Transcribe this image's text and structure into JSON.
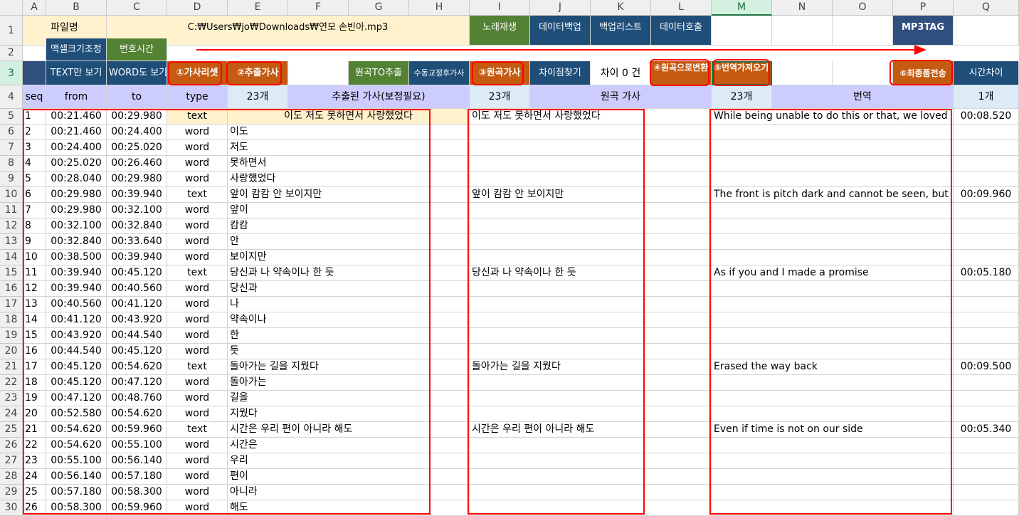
{
  "columns": [
    "A",
    "B",
    "C",
    "D",
    "E",
    "F",
    "G",
    "H",
    "I",
    "J",
    "K",
    "L",
    "M",
    "N",
    "O",
    "P",
    "Q"
  ],
  "row_numbers": [
    "1",
    "2",
    "3",
    "4",
    "5",
    "6",
    "7",
    "8",
    "9",
    "10",
    "11",
    "12",
    "13",
    "14",
    "15",
    "16",
    "17",
    "18",
    "19",
    "20",
    "21",
    "22",
    "23",
    "24",
    "25",
    "26",
    "27",
    "28",
    "29",
    "30"
  ],
  "row1": {
    "file_label": "파일명",
    "file_path": "C:₩Users₩jo₩Downloads₩연모 손빈아.mp3",
    "btn_play": "노래재생",
    "btn_backup": "데이터백업",
    "btn_backup_list": "백업리스트",
    "btn_data_load": "데이터호출",
    "btn_mp3tag": "MP3TAG"
  },
  "row2": {
    "btn_cell_size": "액셀크기조정",
    "btn_number_time": "번호시간"
  },
  "row3": {
    "btn_text_only": "TEXT만 보기",
    "btn_word_view": "WORD도 보기",
    "btn_lyrics_set": "①가사리셋",
    "btn_extract": "②추출가사",
    "btn_original_extract": "원곡TO추출",
    "btn_manual_fix": "수동교정후가사",
    "btn_original_lyrics": "③원곡가사",
    "btn_find_diff": "차이점찾기",
    "diff_count": "차이 0 건",
    "btn_convert_original": "④원곡으로변환",
    "btn_translate": "⑤번역가져오기",
    "btn_final_send": "⑥최종품전송",
    "time_diff_label": "시간차이"
  },
  "row4": {
    "seq": "seq",
    "from": "from",
    "to": "to",
    "type": "type",
    "extract_count": "23개",
    "extract_title": "추출된 가사(보정필요)",
    "original_count": "23개",
    "original_title": "원곡 가사",
    "translation_count": "23개",
    "translation_title": "번역",
    "time_diff_count": "1개"
  },
  "rows": [
    {
      "seq": "1",
      "from": "00:21.460",
      "to": "00:29.980",
      "type": "text",
      "lyric": "이도 저도 못하면서 사랑했었다",
      "original": "이도 저도 못하면서 사랑했었다",
      "translation": "While being unable to do this or that, we loved",
      "diff": "00:08.520"
    },
    {
      "seq": "2",
      "from": "00:21.460",
      "to": "00:24.400",
      "type": "word",
      "lyric": "이도",
      "original": "",
      "translation": "",
      "diff": ""
    },
    {
      "seq": "3",
      "from": "00:24.400",
      "to": "00:25.020",
      "type": "word",
      "lyric": "저도",
      "original": "",
      "translation": "",
      "diff": ""
    },
    {
      "seq": "4",
      "from": "00:25.020",
      "to": "00:26.460",
      "type": "word",
      "lyric": "못하면서",
      "original": "",
      "translation": "",
      "diff": ""
    },
    {
      "seq": "5",
      "from": "00:28.040",
      "to": "00:29.980",
      "type": "word",
      "lyric": "사랑했었다",
      "original": "",
      "translation": "",
      "diff": ""
    },
    {
      "seq": "6",
      "from": "00:29.980",
      "to": "00:39.940",
      "type": "text",
      "lyric": "앞이 캄캄 안 보이지만",
      "original": "앞이 캄캄 안 보이지만",
      "translation": "The front is pitch dark and cannot be seen, but",
      "diff": "00:09.960"
    },
    {
      "seq": "7",
      "from": "00:29.980",
      "to": "00:32.100",
      "type": "word",
      "lyric": "앞이",
      "original": "",
      "translation": "",
      "diff": ""
    },
    {
      "seq": "8",
      "from": "00:32.100",
      "to": "00:32.840",
      "type": "word",
      "lyric": "캄캄",
      "original": "",
      "translation": "",
      "diff": ""
    },
    {
      "seq": "9",
      "from": "00:32.840",
      "to": "00:33.640",
      "type": "word",
      "lyric": "안",
      "original": "",
      "translation": "",
      "diff": ""
    },
    {
      "seq": "10",
      "from": "00:38.500",
      "to": "00:39.940",
      "type": "word",
      "lyric": "보이지만",
      "original": "",
      "translation": "",
      "diff": ""
    },
    {
      "seq": "11",
      "from": "00:39.940",
      "to": "00:45.120",
      "type": "text",
      "lyric": "당신과 나 약속이나 한 듯",
      "original": "당신과 나 약속이나 한 듯",
      "translation": "As if you and I made a promise",
      "diff": "00:05.180"
    },
    {
      "seq": "12",
      "from": "00:39.940",
      "to": "00:40.560",
      "type": "word",
      "lyric": "당신과",
      "original": "",
      "translation": "",
      "diff": ""
    },
    {
      "seq": "13",
      "from": "00:40.560",
      "to": "00:41.120",
      "type": "word",
      "lyric": "나",
      "original": "",
      "translation": "",
      "diff": ""
    },
    {
      "seq": "14",
      "from": "00:41.120",
      "to": "00:43.920",
      "type": "word",
      "lyric": "약속이나",
      "original": "",
      "translation": "",
      "diff": ""
    },
    {
      "seq": "15",
      "from": "00:43.920",
      "to": "00:44.540",
      "type": "word",
      "lyric": "한",
      "original": "",
      "translation": "",
      "diff": ""
    },
    {
      "seq": "16",
      "from": "00:44.540",
      "to": "00:45.120",
      "type": "word",
      "lyric": "듯",
      "original": "",
      "translation": "",
      "diff": ""
    },
    {
      "seq": "17",
      "from": "00:45.120",
      "to": "00:54.620",
      "type": "text",
      "lyric": "돌아가는 길을 지웠다",
      "original": "돌아가는 길을 지웠다",
      "translation": "Erased the way back",
      "diff": "00:09.500"
    },
    {
      "seq": "18",
      "from": "00:45.120",
      "to": "00:47.120",
      "type": "word",
      "lyric": "돌아가는",
      "original": "",
      "translation": "",
      "diff": ""
    },
    {
      "seq": "19",
      "from": "00:47.120",
      "to": "00:48.760",
      "type": "word",
      "lyric": "길을",
      "original": "",
      "translation": "",
      "diff": ""
    },
    {
      "seq": "20",
      "from": "00:52.580",
      "to": "00:54.620",
      "type": "word",
      "lyric": "지웠다",
      "original": "",
      "translation": "",
      "diff": ""
    },
    {
      "seq": "21",
      "from": "00:54.620",
      "to": "00:59.960",
      "type": "text",
      "lyric": "시간은 우리 편이 아니라 해도",
      "original": "시간은 우리 편이 아니라 해도",
      "translation": "Even if time is not on our side",
      "diff": "00:05.340"
    },
    {
      "seq": "22",
      "from": "00:54.620",
      "to": "00:55.100",
      "type": "word",
      "lyric": "시간은",
      "original": "",
      "translation": "",
      "diff": ""
    },
    {
      "seq": "23",
      "from": "00:55.100",
      "to": "00:56.140",
      "type": "word",
      "lyric": "우리",
      "original": "",
      "translation": "",
      "diff": ""
    },
    {
      "seq": "24",
      "from": "00:56.140",
      "to": "00:57.180",
      "type": "word",
      "lyric": "편이",
      "original": "",
      "translation": "",
      "diff": ""
    },
    {
      "seq": "25",
      "from": "00:57.180",
      "to": "00:58.300",
      "type": "word",
      "lyric": "아니라",
      "original": "",
      "translation": "",
      "diff": ""
    },
    {
      "seq": "26",
      "from": "00:58.300",
      "to": "00:59.960",
      "type": "word",
      "lyric": "해도",
      "original": "",
      "translation": "",
      "diff": ""
    }
  ],
  "colors": {
    "accent_red": "#ff0000",
    "navy": "#1f4e79",
    "green": "#548235",
    "orange": "#c55a11",
    "yellow": "#fff2cc",
    "lavender": "#ccccff"
  }
}
